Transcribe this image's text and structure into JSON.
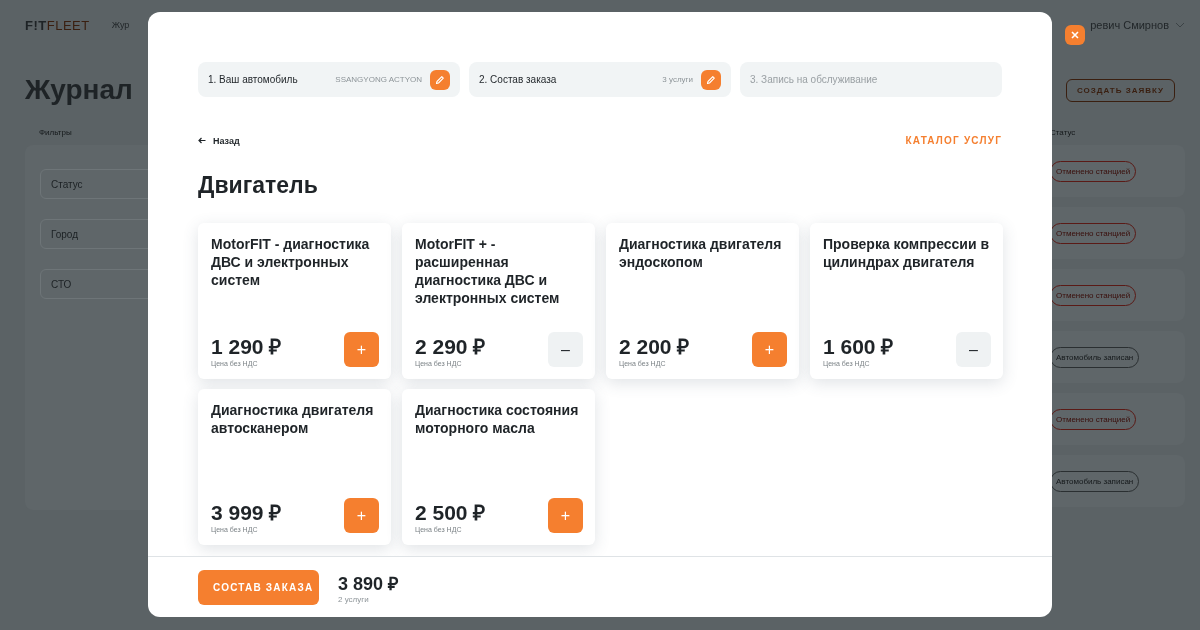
{
  "app": {
    "logo_bold": "F!T",
    "logo_light": "FLEET",
    "nav": [
      "Жур"
    ],
    "user_name": "ревич Смирнов"
  },
  "page": {
    "title": "Журнал",
    "create_button": "СОЗДАТЬ ЗАЯВКУ",
    "filters_label": "Фильтры",
    "filters": [
      {
        "placeholder": "Статус"
      },
      {
        "placeholder": "Город"
      },
      {
        "placeholder": "СТО"
      }
    ],
    "status_header": "Статус",
    "statuses": [
      {
        "label": "Отменено станцией",
        "kind": "cancelled"
      },
      {
        "label": "Отменено станцией",
        "kind": "cancelled"
      },
      {
        "label": "Отменено станцией",
        "kind": "cancelled"
      },
      {
        "label": "Автомобиль записан",
        "kind": "booked"
      },
      {
        "label": "Отменено станцией",
        "kind": "cancelled"
      },
      {
        "label": "Автомобиль записан",
        "kind": "booked"
      }
    ]
  },
  "modal": {
    "steps": [
      {
        "label": "1. Ваш автомобиль",
        "value": "SSANGYONG ACTYON",
        "disabled": false
      },
      {
        "label": "2. Состав заказа",
        "value": "3 услуги",
        "disabled": false
      },
      {
        "label": "3. Запись на обслуживание",
        "disabled": true
      }
    ],
    "back": "Назад",
    "catalog": "КАТАЛОГ УСЛУГ",
    "heading": "Двигатель",
    "services": [
      {
        "title": "MotorFIT - диагностика ДВС и электронных систем",
        "price": "1 290 ₽",
        "note": "Цена без НДС",
        "button": "+",
        "selected": false
      },
      {
        "title": "MotorFIT + - расширенная диагностика ДВС и электронных систем",
        "price": "2 290 ₽",
        "note": "Цена без НДС",
        "button": "–",
        "selected": true
      },
      {
        "title": "Диагностика двигателя эндоскопом",
        "price": "2 200 ₽",
        "note": "Цена без НДС",
        "button": "+",
        "selected": false
      },
      {
        "title": "Проверка компрессии в цилиндрах двигателя",
        "price": "1 600 ₽",
        "note": "Цена без НДС",
        "button": "–",
        "selected": true
      },
      {
        "title": "Диагностика двигателя автосканером",
        "price": "3 999 ₽",
        "note": "Цена без НДС",
        "button": "+",
        "selected": false
      },
      {
        "title": "Диагностика состояния моторного масла",
        "price": "2 500 ₽",
        "note": "Цена без НДС",
        "button": "+",
        "selected": false
      }
    ],
    "footer": {
      "button": "СОСТАВ ЗАКАЗА",
      "total": "3 890 ₽",
      "count": "2 услуги"
    }
  }
}
